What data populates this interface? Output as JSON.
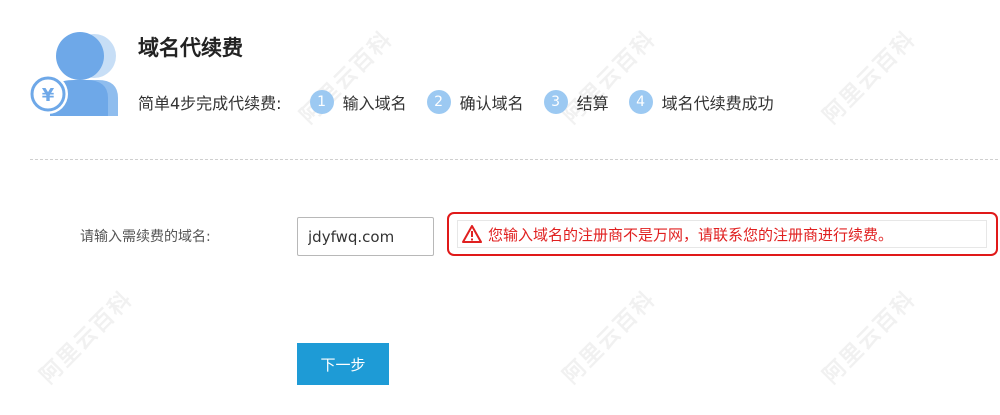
{
  "header": {
    "title": "域名代续费",
    "icon": "user-yen-icon",
    "steps_intro": "简单4步完成代续费:",
    "steps": [
      {
        "num": "1",
        "label": "输入域名"
      },
      {
        "num": "2",
        "label": "确认域名"
      },
      {
        "num": "3",
        "label": "结算"
      },
      {
        "num": "4",
        "label": "域名代续费成功"
      }
    ]
  },
  "form": {
    "domain_label": "请输入需续费的域名:",
    "domain_value": "jdyfwq.com",
    "error_message": "您输入域名的注册商不是万网，请联系您的注册商进行续费。",
    "error_icon": "warning-triangle-icon",
    "next_label": "下一步"
  },
  "watermark": {
    "text": "阿里云百科"
  },
  "colors": {
    "step_circle": "#9cc9f2",
    "error_red": "#e02020",
    "button_blue": "#1e9bd6"
  }
}
